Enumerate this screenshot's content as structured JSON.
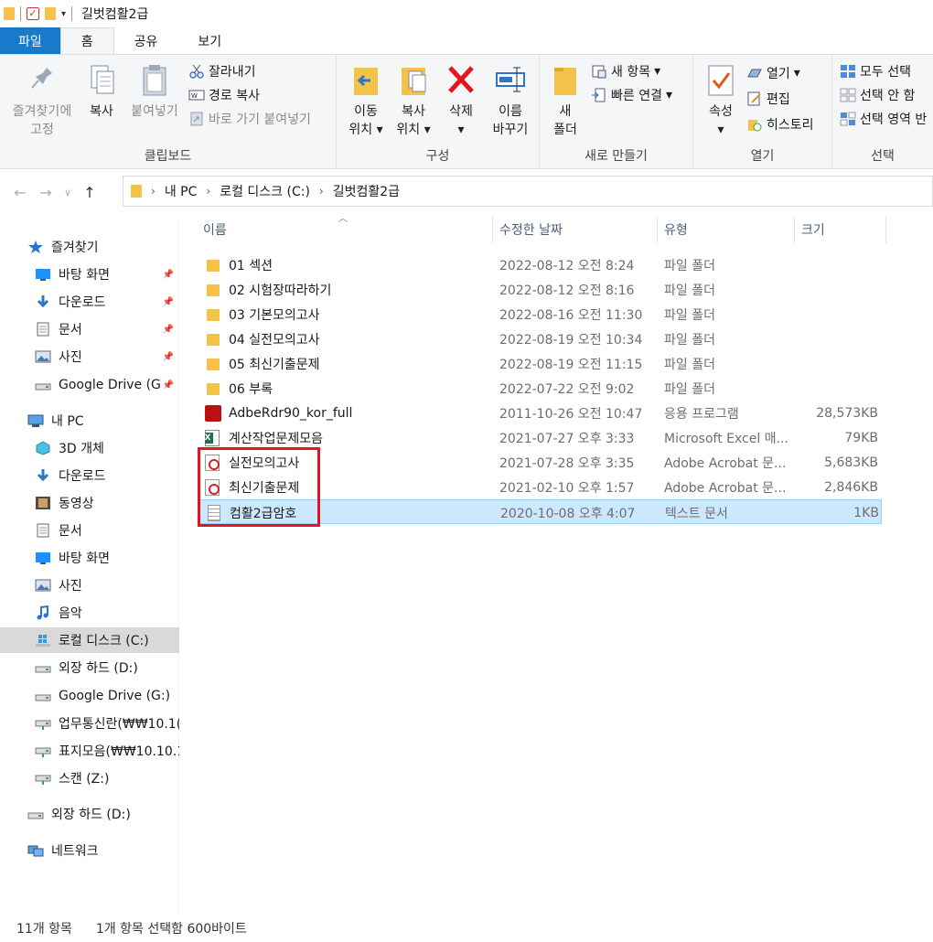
{
  "window": {
    "title": "길벗컴활2급"
  },
  "tabs": [
    {
      "label": "파일"
    },
    {
      "label": "홈"
    },
    {
      "label": "공유"
    },
    {
      "label": "보기"
    }
  ],
  "ribbon": {
    "clipboard": {
      "label": "클립보드",
      "pin_l1": "즐겨찾기에",
      "pin_l2": "고정",
      "copy": "복사",
      "paste": "붙여넣기",
      "cut": "잘라내기",
      "copy_path": "경로 복사",
      "paste_shortcut": "바로 가기 붙여넣기"
    },
    "organize": {
      "label": "구성",
      "move_l1": "이동",
      "move_l2": "위치",
      "copyto_l1": "복사",
      "copyto_l2": "위치",
      "delete": "삭제",
      "rename_l1": "이름",
      "rename_l2": "바꾸기"
    },
    "new": {
      "label": "새로 만들기",
      "folder_l1": "새",
      "folder_l2": "폴더",
      "new_item": "새 항목",
      "easy_access": "빠른 연결"
    },
    "open": {
      "label": "열기",
      "properties": "속성",
      "open": "열기",
      "edit": "편집",
      "history": "히스토리"
    },
    "select": {
      "label": "선택",
      "select_all": "모두 선택",
      "select_none": "선택 안 함",
      "invert": "선택 영역 반"
    }
  },
  "address": {
    "crumbs": [
      "내 PC",
      "로컬 디스크 (C:)",
      "길벗컴활2급"
    ]
  },
  "sidebar": {
    "items": [
      {
        "label": "즐겨찾기",
        "icon": "star-icon"
      },
      {
        "label": "바탕 화면",
        "icon": "desktop-icon"
      },
      {
        "label": "다운로드",
        "icon": "download-icon"
      },
      {
        "label": "문서",
        "icon": "document-icon"
      },
      {
        "label": "사진",
        "icon": "picture-icon"
      },
      {
        "label": "Google Drive (G",
        "icon": "drive-icon"
      },
      {
        "label": "내 PC",
        "icon": "pc-icon"
      },
      {
        "label": "3D 개체",
        "icon": "cube-icon"
      },
      {
        "label": "다운로드",
        "icon": "download-icon"
      },
      {
        "label": "동영상",
        "icon": "video-icon"
      },
      {
        "label": "문서",
        "icon": "document-icon"
      },
      {
        "label": "바탕 화면",
        "icon": "desktop-icon"
      },
      {
        "label": "사진",
        "icon": "picture-icon"
      },
      {
        "label": "음악",
        "icon": "music-icon"
      },
      {
        "label": "로컬 디스크 (C:)",
        "icon": "windows-drive-icon"
      },
      {
        "label": "외장 하드 (D:)",
        "icon": "drive-icon"
      },
      {
        "label": "Google Drive (G:)",
        "icon": "drive-icon"
      },
      {
        "label": "업무통신란(₩₩10.1(",
        "icon": "network-drive-icon"
      },
      {
        "label": "표지모음(₩₩10.10.1",
        "icon": "network-drive-icon"
      },
      {
        "label": "스캔 (Z:)",
        "icon": "network-drive-icon"
      },
      {
        "label": "외장 하드 (D:)",
        "icon": "drive-icon"
      },
      {
        "label": "네트워크",
        "icon": "network-icon"
      }
    ]
  },
  "columns": {
    "name": "이름",
    "date": "수정한 날짜",
    "type": "유형",
    "size": "크기"
  },
  "files": [
    {
      "name": "01 섹션",
      "date": "2022-08-12 오전 8:24",
      "type": "파일 폴더",
      "size": "",
      "icon": "folder-icon"
    },
    {
      "name": "02 시험장따라하기",
      "date": "2022-08-12 오전 8:16",
      "type": "파일 폴더",
      "size": "",
      "icon": "folder-icon"
    },
    {
      "name": "03 기본모의고사",
      "date": "2022-08-16 오전 11:30",
      "type": "파일 폴더",
      "size": "",
      "icon": "folder-icon"
    },
    {
      "name": "04 실전모의고사",
      "date": "2022-08-19 오전 10:34",
      "type": "파일 폴더",
      "size": "",
      "icon": "folder-icon"
    },
    {
      "name": "05 최신기출문제",
      "date": "2022-08-19 오전 11:15",
      "type": "파일 폴더",
      "size": "",
      "icon": "folder-icon"
    },
    {
      "name": "06 부록",
      "date": "2022-07-22 오전 9:02",
      "type": "파일 폴더",
      "size": "",
      "icon": "folder-icon"
    },
    {
      "name": "AdbeRdr90_kor_full",
      "date": "2011-10-26 오전 10:47",
      "type": "응용 프로그램",
      "size": "28,573KB",
      "icon": "app-icon"
    },
    {
      "name": "계산작업문제모음",
      "date": "2021-07-27 오후 3:33",
      "type": "Microsoft Excel 매...",
      "size": "79KB",
      "icon": "excel-icon"
    },
    {
      "name": "실전모의고사",
      "date": "2021-07-28 오후 3:35",
      "type": "Adobe Acrobat 문...",
      "size": "5,683KB",
      "icon": "pdf-icon"
    },
    {
      "name": "최신기출문제",
      "date": "2021-02-10 오후 1:57",
      "type": "Adobe Acrobat 문...",
      "size": "2,846KB",
      "icon": "pdf-icon"
    },
    {
      "name": "컴활2급암호",
      "date": "2020-10-08 오후 4:07",
      "type": "텍스트 문서",
      "size": "1KB",
      "icon": "text-icon"
    }
  ],
  "status": {
    "count": "11개 항목",
    "selection": "1개 항목 선택함 600바이트"
  }
}
